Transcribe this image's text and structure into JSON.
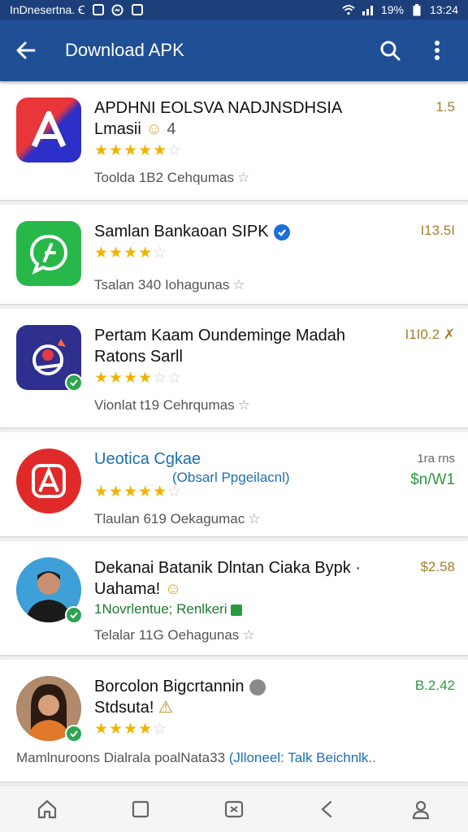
{
  "status_bar": {
    "carrier": "InDnesertna. Ꞓ",
    "battery": "19%",
    "time": "13:24"
  },
  "app_bar": {
    "title": "Download APK"
  },
  "apps": [
    {
      "name_line1": "APDHNI EOLSVA NADJNSDHSIA",
      "name_line2": "Lmasii",
      "stars_on": "★★★★★",
      "stars_off": "☆",
      "meta": "Toolda 1B2 Cehqumas",
      "price": "1.5",
      "icon_bg": "#d92f2f",
      "icon_color2": "#3344cc"
    },
    {
      "name_line1": "Samlan Bankaoan SIPK",
      "stars_on": "★★★★",
      "stars_off": "☆",
      "meta": "Tsalan 340 Iohagunas",
      "price": "I13.5I",
      "icon_bg": "#28b84a"
    },
    {
      "name_line1": "Pertam Kaam Oundeminge Madah",
      "name_line2": "Ratons Sarll",
      "stars_on": "★★★★",
      "stars_off": "☆☆",
      "meta": "Vionlat t19 Cehrqumas",
      "price": "I1I0.2 ✗",
      "icon_bg": "#2e2f8f"
    },
    {
      "name_line1": "Ueotica Cgkae",
      "sub": "(Obsarl Ppgeilacnl)",
      "stars_on": "★★★★★",
      "stars_off": "☆",
      "meta": "Tlaulan 619 Oekagumac",
      "price_line1": "1ra rns",
      "price": "$n/W1",
      "icon_bg": "#e02a2a"
    },
    {
      "name_line1": "Dekanai Batanik Dlntan Ciaka Bypk ·",
      "name_line2": "Uahama!",
      "sub": "1Novrlentue; Renlkeri",
      "meta": "Telalar 11G Oehagunas",
      "price": "$2.58",
      "icon_bg": "#3fa0d8"
    },
    {
      "name_line1": "Borcolon Bigcrtannin",
      "name_line2": "Stdsuta!",
      "stars_on": "★★★★",
      "stars_off": "☆",
      "meta": "Mamlnuroons Dialrala poalNata33",
      "meta_link": "(Jlloneel: Talk Beichnlk..",
      "price": "B.2.42",
      "icon_bg": "#8a5a3a"
    }
  ],
  "colors": {
    "status_bar": "#1c3f7a",
    "app_bar": "#1f4f95",
    "star": "#f0b400",
    "verified": "#2ea44f"
  }
}
